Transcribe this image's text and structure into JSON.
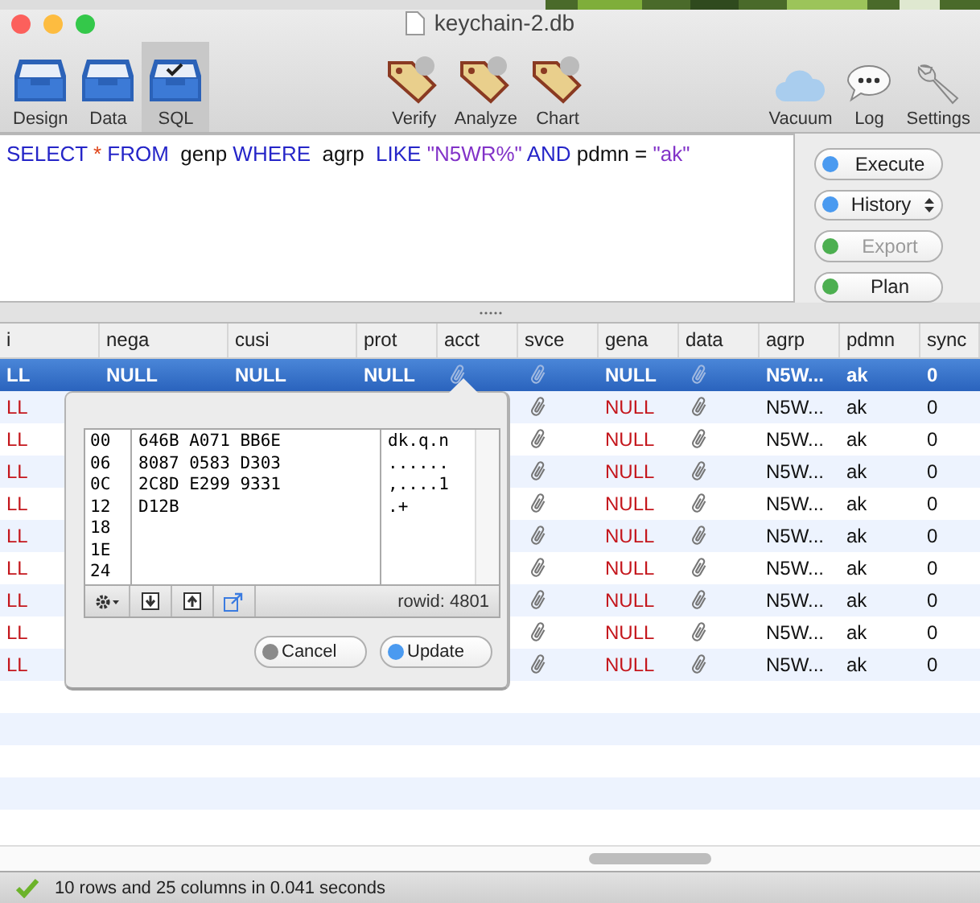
{
  "window": {
    "title": "keychain-2.db"
  },
  "toolbar": [
    {
      "label": "Design",
      "kind": "tray",
      "selected": false
    },
    {
      "label": "Data",
      "kind": "tray",
      "selected": false
    },
    {
      "label": "SQL",
      "kind": "tray",
      "selected": true
    },
    {
      "label": "Verify",
      "kind": "tag",
      "selected": false
    },
    {
      "label": "Analyze",
      "kind": "tag",
      "selected": false
    },
    {
      "label": "Chart",
      "kind": "tag",
      "selected": false
    },
    {
      "label": "Vacuum",
      "kind": "cloud",
      "selected": false
    },
    {
      "label": "Log",
      "kind": "bubble",
      "selected": false
    },
    {
      "label": "Settings",
      "kind": "wrench",
      "selected": false
    }
  ],
  "query": [
    {
      "kind": "keyword",
      "text": "SELECT "
    },
    {
      "kind": "op",
      "text": "* "
    },
    {
      "kind": "keyword",
      "text": "FROM  "
    },
    {
      "kind": "ident",
      "text": "genp "
    },
    {
      "kind": "keyword",
      "text": "WHERE  "
    },
    {
      "kind": "ident",
      "text": "agrp  "
    },
    {
      "kind": "keyword",
      "text": "LIKE "
    },
    {
      "kind": "string",
      "text": "\"N5WR%\" "
    },
    {
      "kind": "keyword",
      "text": "AND "
    },
    {
      "kind": "ident",
      "text": "pdmn = "
    },
    {
      "kind": "string",
      "text": "\"ak\""
    }
  ],
  "side_buttons": [
    {
      "label": "Execute",
      "color": "#4a9af0",
      "disabled": false,
      "dropdown": false
    },
    {
      "label": "History",
      "color": "#4a9af0",
      "disabled": false,
      "dropdown": true
    },
    {
      "label": "Export",
      "color": "#4caf50",
      "disabled": true,
      "dropdown": false
    },
    {
      "label": "Plan",
      "color": "#4caf50",
      "disabled": false,
      "dropdown": false
    }
  ],
  "table": {
    "columns": [
      "i",
      "nega",
      "cusi",
      "prot",
      "acct",
      "svce",
      "gena",
      "data",
      "agrp",
      "pdmn",
      "sync"
    ],
    "rows": [
      {
        "selected": true,
        "cells": [
          {
            "kind": "null",
            "text": "LL"
          },
          {
            "kind": "null",
            "text": "NULL"
          },
          {
            "kind": "null",
            "text": "NULL"
          },
          {
            "kind": "null",
            "text": "NULL"
          },
          {
            "kind": "blob"
          },
          {
            "kind": "blob"
          },
          {
            "kind": "null",
            "text": "NULL"
          },
          {
            "kind": "blob"
          },
          {
            "kind": "text",
            "text": "N5W..."
          },
          {
            "kind": "text",
            "text": "ak"
          },
          {
            "kind": "text",
            "text": "0"
          }
        ]
      },
      {
        "selected": false,
        "cells": [
          {
            "kind": "null",
            "text": "LL"
          },
          {
            "kind": "covered"
          },
          {
            "kind": "covered"
          },
          {
            "kind": "covered"
          },
          {
            "kind": "covered"
          },
          {
            "kind": "blob"
          },
          {
            "kind": "null",
            "text": "NULL"
          },
          {
            "kind": "blob"
          },
          {
            "kind": "text",
            "text": "N5W..."
          },
          {
            "kind": "text",
            "text": "ak"
          },
          {
            "kind": "text",
            "text": "0"
          }
        ]
      },
      {
        "selected": false,
        "cells": [
          {
            "kind": "null",
            "text": "LL"
          },
          {
            "kind": "covered"
          },
          {
            "kind": "covered"
          },
          {
            "kind": "covered"
          },
          {
            "kind": "covered"
          },
          {
            "kind": "blob"
          },
          {
            "kind": "null",
            "text": "NULL"
          },
          {
            "kind": "blob"
          },
          {
            "kind": "text",
            "text": "N5W..."
          },
          {
            "kind": "text",
            "text": "ak"
          },
          {
            "kind": "text",
            "text": "0"
          }
        ]
      },
      {
        "selected": false,
        "cells": [
          {
            "kind": "null",
            "text": "LL"
          },
          {
            "kind": "covered"
          },
          {
            "kind": "covered"
          },
          {
            "kind": "covered"
          },
          {
            "kind": "covered"
          },
          {
            "kind": "blob"
          },
          {
            "kind": "null",
            "text": "NULL"
          },
          {
            "kind": "blob"
          },
          {
            "kind": "text",
            "text": "N5W..."
          },
          {
            "kind": "text",
            "text": "ak"
          },
          {
            "kind": "text",
            "text": "0"
          }
        ]
      },
      {
        "selected": false,
        "cells": [
          {
            "kind": "null",
            "text": "LL"
          },
          {
            "kind": "covered"
          },
          {
            "kind": "covered"
          },
          {
            "kind": "covered"
          },
          {
            "kind": "covered"
          },
          {
            "kind": "blob"
          },
          {
            "kind": "null",
            "text": "NULL"
          },
          {
            "kind": "blob"
          },
          {
            "kind": "text",
            "text": "N5W..."
          },
          {
            "kind": "text",
            "text": "ak"
          },
          {
            "kind": "text",
            "text": "0"
          }
        ]
      },
      {
        "selected": false,
        "cells": [
          {
            "kind": "null",
            "text": "LL"
          },
          {
            "kind": "covered"
          },
          {
            "kind": "covered"
          },
          {
            "kind": "covered"
          },
          {
            "kind": "covered"
          },
          {
            "kind": "blob"
          },
          {
            "kind": "null",
            "text": "NULL"
          },
          {
            "kind": "blob"
          },
          {
            "kind": "text",
            "text": "N5W..."
          },
          {
            "kind": "text",
            "text": "ak"
          },
          {
            "kind": "text",
            "text": "0"
          }
        ]
      },
      {
        "selected": false,
        "cells": [
          {
            "kind": "null",
            "text": "LL"
          },
          {
            "kind": "covered"
          },
          {
            "kind": "covered"
          },
          {
            "kind": "covered"
          },
          {
            "kind": "covered"
          },
          {
            "kind": "blob"
          },
          {
            "kind": "null",
            "text": "NULL"
          },
          {
            "kind": "blob"
          },
          {
            "kind": "text",
            "text": "N5W..."
          },
          {
            "kind": "text",
            "text": "ak"
          },
          {
            "kind": "text",
            "text": "0"
          }
        ]
      },
      {
        "selected": false,
        "cells": [
          {
            "kind": "null",
            "text": "LL"
          },
          {
            "kind": "covered"
          },
          {
            "kind": "covered"
          },
          {
            "kind": "covered"
          },
          {
            "kind": "covered"
          },
          {
            "kind": "blob"
          },
          {
            "kind": "null",
            "text": "NULL"
          },
          {
            "kind": "blob"
          },
          {
            "kind": "text",
            "text": "N5W..."
          },
          {
            "kind": "text",
            "text": "ak"
          },
          {
            "kind": "text",
            "text": "0"
          }
        ]
      },
      {
        "selected": false,
        "cells": [
          {
            "kind": "null",
            "text": "LL"
          },
          {
            "kind": "covered"
          },
          {
            "kind": "covered"
          },
          {
            "kind": "covered"
          },
          {
            "kind": "covered"
          },
          {
            "kind": "blob"
          },
          {
            "kind": "null",
            "text": "NULL"
          },
          {
            "kind": "blob"
          },
          {
            "kind": "text",
            "text": "N5W..."
          },
          {
            "kind": "text",
            "text": "ak"
          },
          {
            "kind": "text",
            "text": "0"
          }
        ]
      },
      {
        "selected": false,
        "cells": [
          {
            "kind": "null",
            "text": "LL"
          },
          {
            "kind": "covered"
          },
          {
            "kind": "covered"
          },
          {
            "kind": "covered"
          },
          {
            "kind": "covered"
          },
          {
            "kind": "blob"
          },
          {
            "kind": "null",
            "text": "NULL"
          },
          {
            "kind": "blob"
          },
          {
            "kind": "text",
            "text": "N5W..."
          },
          {
            "kind": "text",
            "text": "ak"
          },
          {
            "kind": "text",
            "text": "0"
          }
        ]
      }
    ]
  },
  "popover": {
    "offsets": [
      "00",
      "06",
      "0C",
      "12",
      "18",
      "1E",
      "24"
    ],
    "hex": [
      "646B A071 BB6E",
      "8087 0583 D303",
      "2C8D E299 9331",
      "D12B"
    ],
    "ascii": [
      "dk.q.n",
      "......",
      ",....1",
      ".+"
    ],
    "rowid": "rowid: 4801",
    "buttons": [
      {
        "label": "Cancel",
        "color": "#8a8a8a"
      },
      {
        "label": "Update",
        "color": "#4a9af0"
      }
    ]
  },
  "status_bar": {
    "ok": true,
    "text": "10 rows and 25 columns in 0.041 seconds"
  }
}
